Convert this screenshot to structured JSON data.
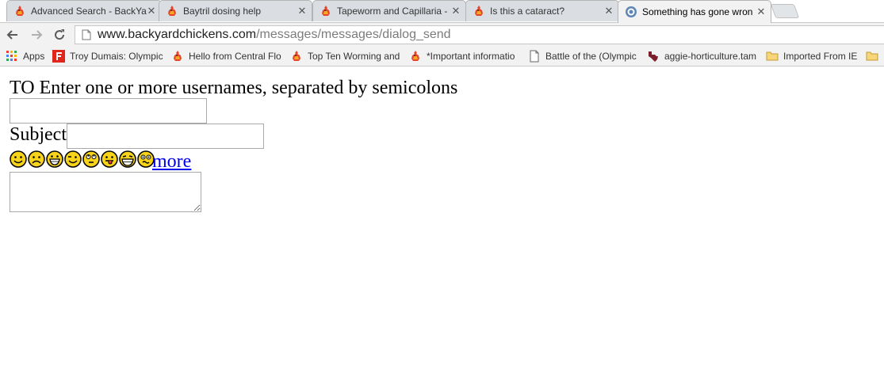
{
  "browser": {
    "tabs": [
      {
        "title": "Advanced Search - BackYa",
        "favicon": "chicken-favicon"
      },
      {
        "title": "Baytril dosing help",
        "favicon": "chicken-favicon"
      },
      {
        "title": "Tapeworm and Capillaria -",
        "favicon": "chicken-favicon"
      },
      {
        "title": "Is this a cataract?",
        "favicon": "chicken-favicon"
      },
      {
        "title": "Something has gone wron",
        "favicon": "globe-favicon",
        "active": true
      }
    ],
    "address": {
      "domain": "www.backyardchickens.com",
      "path": "/messages/messages/dialog_send"
    },
    "bookmarks": [
      {
        "label": "Apps",
        "icon": "apps-grid-icon"
      },
      {
        "label": "Troy Dumais: Olympic",
        "icon": "red-f-icon"
      },
      {
        "label": "Hello from Central Flo",
        "icon": "chicken-favicon"
      },
      {
        "label": "Top Ten Worming and",
        "icon": "chicken-favicon"
      },
      {
        "label": "*Important informatio",
        "icon": "chicken-favicon"
      },
      {
        "label": "Battle of the (Olympic",
        "icon": "page-icon"
      },
      {
        "label": "aggie-horticulture.tam",
        "icon": "texas-icon"
      },
      {
        "label": "Imported From IE",
        "icon": "folder-icon"
      },
      {
        "label": "",
        "icon": "folder-icon"
      }
    ]
  },
  "form": {
    "to_label": "TO",
    "to_hint": "Enter one or more usernames, separated by semicolons",
    "to_value": "",
    "subject_label": "Subject",
    "subject_value": "",
    "smileys": [
      "smile",
      "frown",
      "grin",
      "wink",
      "roll-eyes",
      "tongue",
      "laugh",
      "confused"
    ],
    "more_link": "more",
    "message_value": ""
  }
}
